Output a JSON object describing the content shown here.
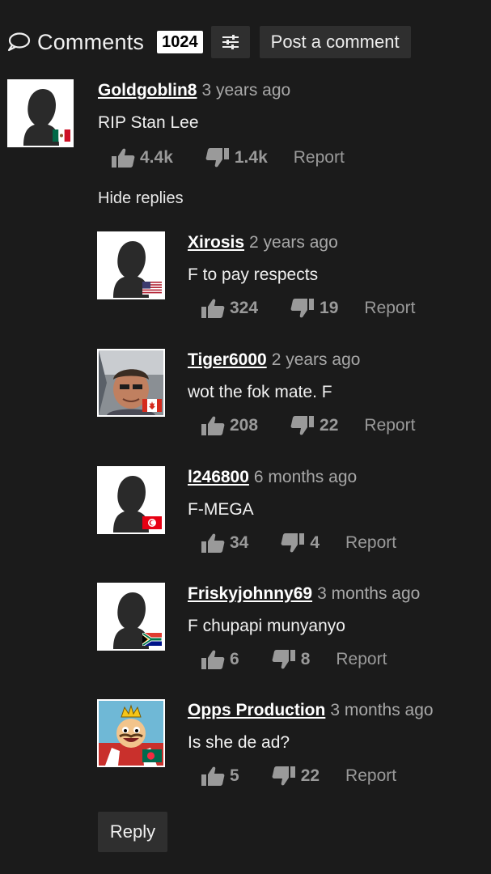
{
  "header": {
    "title": "Comments",
    "count": "1024",
    "post_label": "Post a comment"
  },
  "main_comment": {
    "user": "Goldgoblin8",
    "time": "3 years ago",
    "text": "RIP Stan Lee",
    "likes": "4.4k",
    "dislikes": "1.4k",
    "report": "Report",
    "flag": "mexico-flag-icon"
  },
  "hide_replies": "Hide replies",
  "replies": [
    {
      "user": "Xirosis",
      "time": "2 years ago",
      "text": "F to pay respects",
      "likes": "324",
      "dislikes": "19",
      "report": "Report",
      "flag": "usa-flag-icon"
    },
    {
      "user": "Tiger6000",
      "time": "2 years ago",
      "text": "wot the fok mate. F",
      "likes": "208",
      "dislikes": "22",
      "report": "Report",
      "flag": "canada-flag-icon"
    },
    {
      "user": "l246800",
      "time": "6 months ago",
      "text": "F-MEGA",
      "likes": "34",
      "dislikes": "4",
      "report": "Report",
      "flag": "tunisia-flag-icon"
    },
    {
      "user": "Friskyjohnny69",
      "time": "3 months ago",
      "text": "F chupapi munyanyo",
      "likes": "6",
      "dislikes": "8",
      "report": "Report",
      "flag": "south-africa-flag-icon"
    },
    {
      "user": "Opps Production",
      "time": "3 months ago",
      "text": "Is she de ad?",
      "likes": "5",
      "dislikes": "22",
      "report": "Report",
      "flag": "bangladesh-flag-icon"
    }
  ],
  "reply_label": "Reply",
  "colors": {
    "background": "#1b1b1b",
    "button": "#2f2f2f",
    "muted": "#9a9a9a"
  }
}
